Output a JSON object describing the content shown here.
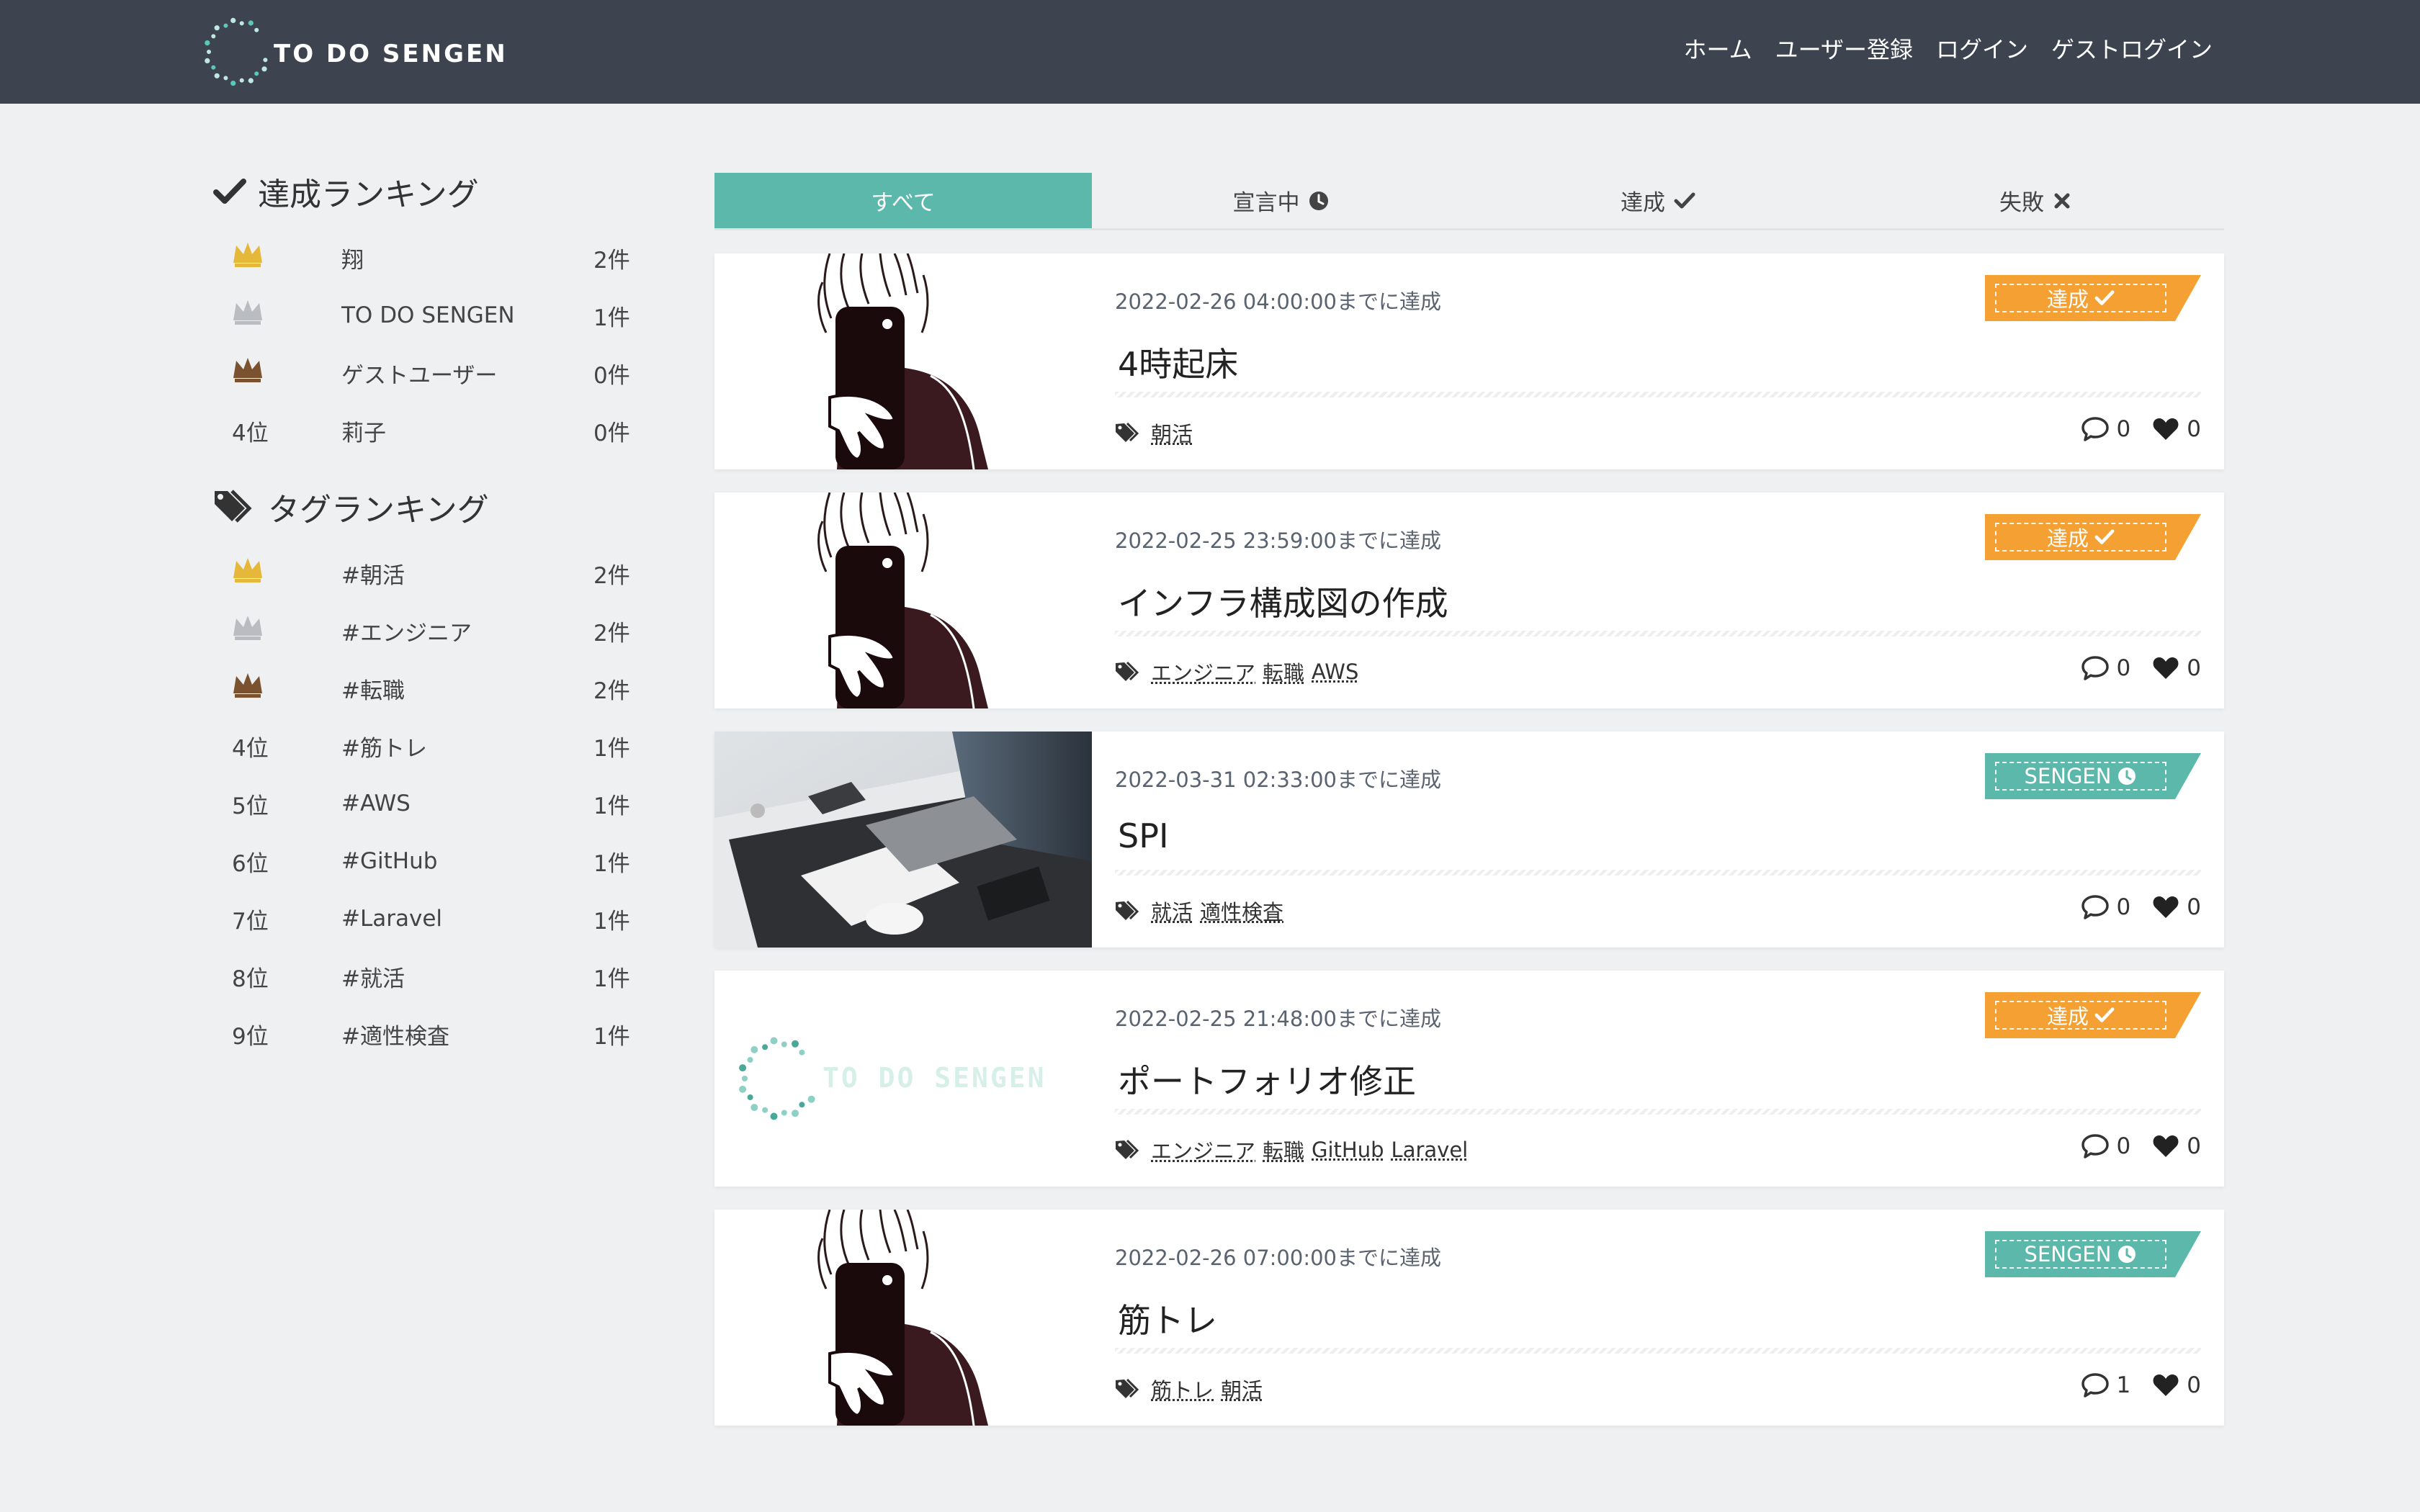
{
  "header": {
    "logo_text": "TO DO SENGEN",
    "nav": [
      "ホーム",
      "ユーザー登録",
      "ログイン",
      "ゲストログイン"
    ]
  },
  "sidebar": {
    "achievement_title": "達成ランキング",
    "achievement_ranking": [
      {
        "rank": "crown-gold",
        "name": "翔",
        "count": "2件"
      },
      {
        "rank": "crown-silver",
        "name": "TO DO SENGEN",
        "count": "1件"
      },
      {
        "rank": "crown-bronze",
        "name": "ゲストユーザー",
        "count": "0件"
      },
      {
        "rank": "4位",
        "name": "莉子",
        "count": "0件"
      }
    ],
    "tag_title": "タグランキング",
    "tag_ranking": [
      {
        "rank": "crown-gold",
        "name": "#朝活",
        "count": "2件"
      },
      {
        "rank": "crown-silver",
        "name": "#エンジニア",
        "count": "2件"
      },
      {
        "rank": "crown-bronze",
        "name": "#転職",
        "count": "2件"
      },
      {
        "rank": "4位",
        "name": "#筋トレ",
        "count": "1件"
      },
      {
        "rank": "5位",
        "name": "#AWS",
        "count": "1件"
      },
      {
        "rank": "6位",
        "name": "#GitHub",
        "count": "1件"
      },
      {
        "rank": "7位",
        "name": "#Laravel",
        "count": "1件"
      },
      {
        "rank": "8位",
        "name": "#就活",
        "count": "1件"
      },
      {
        "rank": "9位",
        "name": "#適性検査",
        "count": "1件"
      }
    ]
  },
  "tabs": [
    {
      "label": "すべて",
      "icon": "",
      "active": true
    },
    {
      "label": "宣言中",
      "icon": "clock-icon",
      "active": false
    },
    {
      "label": "達成",
      "icon": "check-icon",
      "active": false
    },
    {
      "label": "失敗",
      "icon": "x-icon",
      "active": false
    }
  ],
  "posts": [
    {
      "thumb": "illustration",
      "deadline": "2022-02-26 04:00:00までに達成",
      "title": "4時起床",
      "tags": [
        "朝活"
      ],
      "comments": "0",
      "likes": "0",
      "badge": {
        "label": "達成",
        "type": "done"
      }
    },
    {
      "thumb": "illustration",
      "deadline": "2022-02-25 23:59:00までに達成",
      "title": "インフラ構成図の作成",
      "tags": [
        "エンジニア",
        "転職",
        "AWS"
      ],
      "comments": "0",
      "likes": "0",
      "badge": {
        "label": "達成",
        "type": "done"
      }
    },
    {
      "thumb": "desk-photo",
      "deadline": "2022-03-31 02:33:00までに達成",
      "title": "SPI",
      "tags": [
        "就活",
        "適性検査"
      ],
      "comments": "0",
      "likes": "0",
      "badge": {
        "label": "SENGEN",
        "type": "sengen"
      }
    },
    {
      "thumb": "logo",
      "thumb_text": "TO DO SENGEN",
      "deadline": "2022-02-25 21:48:00までに達成",
      "title": "ポートフォリオ修正",
      "tags": [
        "エンジニア",
        "転職",
        "GitHub",
        "Laravel"
      ],
      "comments": "0",
      "likes": "0",
      "badge": {
        "label": "達成",
        "type": "done"
      }
    },
    {
      "thumb": "illustration",
      "deadline": "2022-02-26 07:00:00までに達成",
      "title": "筋トレ",
      "tags": [
        "筋トレ",
        "朝活"
      ],
      "comments": "1",
      "likes": "0",
      "badge": {
        "label": "SENGEN",
        "type": "sengen"
      }
    }
  ],
  "colors": {
    "header_bg": "#3d4450",
    "accent_teal": "#5cb8ab",
    "badge_done": "#f4a033",
    "gold": "#e6b83a",
    "silver": "#b9bcc0",
    "bronze": "#7a5230"
  }
}
